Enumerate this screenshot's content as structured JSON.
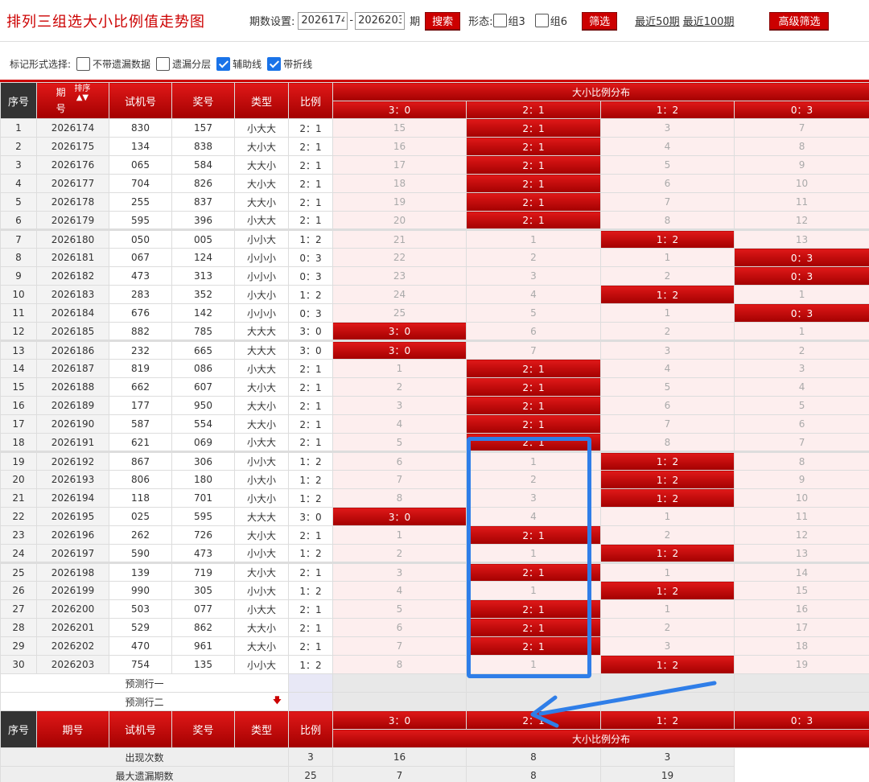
{
  "header": {
    "title": "排列三组选大小比例值走势图",
    "period_label": "期数设置:",
    "period_start": "2026174",
    "period_sep": "-",
    "period_end": "2026203",
    "period_unit": "期",
    "search_label": "搜索",
    "form_label": "形态:",
    "group3_label": "组3",
    "group6_label": "组6",
    "filter_label": "筛选",
    "recent50": "最近50期",
    "recent100": "最近100期",
    "advanced_label": "高级筛选"
  },
  "marks": {
    "label": "标记形式选择:",
    "options": [
      {
        "label": "不带遗漏数据",
        "checked": false
      },
      {
        "label": "遗漏分层",
        "checked": false
      },
      {
        "label": "辅助线",
        "checked": true
      },
      {
        "label": "带折线",
        "checked": true
      }
    ]
  },
  "table": {
    "col_seq": "序号",
    "col_period": "期号",
    "col_sort": "排序",
    "col_test": "试机号",
    "col_prize": "奖号",
    "col_type": "类型",
    "col_ratio": "比例",
    "dist_title": "大小比例分布",
    "dist_cols": [
      "3：0",
      "2：1",
      "1：2",
      "0：3"
    ],
    "rows": [
      [
        "1",
        "2026174",
        "830",
        "157",
        "小大大",
        "2：1",
        [
          "15",
          "2：1",
          "3",
          "7"
        ],
        1
      ],
      [
        "2",
        "2026175",
        "134",
        "838",
        "大小大",
        "2：1",
        [
          "16",
          "2：1",
          "4",
          "8"
        ],
        1
      ],
      [
        "3",
        "2026176",
        "065",
        "584",
        "大大小",
        "2：1",
        [
          "17",
          "2：1",
          "5",
          "9"
        ],
        1
      ],
      [
        "4",
        "2026177",
        "704",
        "826",
        "大小大",
        "2：1",
        [
          "18",
          "2：1",
          "6",
          "10"
        ],
        1
      ],
      [
        "5",
        "2026178",
        "255",
        "837",
        "大大小",
        "2：1",
        [
          "19",
          "2：1",
          "7",
          "11"
        ],
        1
      ],
      [
        "6",
        "2026179",
        "595",
        "396",
        "小大大",
        "2：1",
        [
          "20",
          "2：1",
          "8",
          "12"
        ],
        1
      ],
      [
        "7",
        "2026180",
        "050",
        "005",
        "小小大",
        "1：2",
        [
          "21",
          "1",
          "1：2",
          "13"
        ],
        2
      ],
      [
        "8",
        "2026181",
        "067",
        "124",
        "小小小",
        "0：3",
        [
          "22",
          "2",
          "1",
          "0：3"
        ],
        3
      ],
      [
        "9",
        "2026182",
        "473",
        "313",
        "小小小",
        "0：3",
        [
          "23",
          "3",
          "2",
          "0：3"
        ],
        3
      ],
      [
        "10",
        "2026183",
        "283",
        "352",
        "小大小",
        "1：2",
        [
          "24",
          "4",
          "1：2",
          "1"
        ],
        2
      ],
      [
        "11",
        "2026184",
        "676",
        "142",
        "小小小",
        "0：3",
        [
          "25",
          "5",
          "1",
          "0：3"
        ],
        3
      ],
      [
        "12",
        "2026185",
        "882",
        "785",
        "大大大",
        "3：0",
        [
          "3：0",
          "6",
          "2",
          "1"
        ],
        0
      ],
      [
        "13",
        "2026186",
        "232",
        "665",
        "大大大",
        "3：0",
        [
          "3：0",
          "7",
          "3",
          "2"
        ],
        0
      ],
      [
        "14",
        "2026187",
        "819",
        "086",
        "小大大",
        "2：1",
        [
          "1",
          "2：1",
          "4",
          "3"
        ],
        1
      ],
      [
        "15",
        "2026188",
        "662",
        "607",
        "大小大",
        "2：1",
        [
          "2",
          "2：1",
          "5",
          "4"
        ],
        1
      ],
      [
        "16",
        "2026189",
        "177",
        "950",
        "大大小",
        "2：1",
        [
          "3",
          "2：1",
          "6",
          "5"
        ],
        1
      ],
      [
        "17",
        "2026190",
        "587",
        "554",
        "大大小",
        "2：1",
        [
          "4",
          "2：1",
          "7",
          "6"
        ],
        1
      ],
      [
        "18",
        "2026191",
        "621",
        "069",
        "小大大",
        "2：1",
        [
          "5",
          "2：1",
          "8",
          "7"
        ],
        1
      ],
      [
        "19",
        "2026192",
        "867",
        "306",
        "小小大",
        "1：2",
        [
          "6",
          "1",
          "1：2",
          "8"
        ],
        2
      ],
      [
        "20",
        "2026193",
        "806",
        "180",
        "小大小",
        "1：2",
        [
          "7",
          "2",
          "1：2",
          "9"
        ],
        2
      ],
      [
        "21",
        "2026194",
        "118",
        "701",
        "小大小",
        "1：2",
        [
          "8",
          "3",
          "1：2",
          "10"
        ],
        2
      ],
      [
        "22",
        "2026195",
        "025",
        "595",
        "大大大",
        "3：0",
        [
          "3：0",
          "4",
          "1",
          "11"
        ],
        0
      ],
      [
        "23",
        "2026196",
        "262",
        "726",
        "大小大",
        "2：1",
        [
          "1",
          "2：1",
          "2",
          "12"
        ],
        1
      ],
      [
        "24",
        "2026197",
        "590",
        "473",
        "小小大",
        "1：2",
        [
          "2",
          "1",
          "1：2",
          "13"
        ],
        2
      ],
      [
        "25",
        "2026198",
        "139",
        "719",
        "大小大",
        "2：1",
        [
          "3",
          "2：1",
          "1",
          "14"
        ],
        1
      ],
      [
        "26",
        "2026199",
        "990",
        "305",
        "小小大",
        "1：2",
        [
          "4",
          "1",
          "1：2",
          "15"
        ],
        2
      ],
      [
        "27",
        "2026200",
        "503",
        "077",
        "小大大",
        "2：1",
        [
          "5",
          "2：1",
          "1",
          "16"
        ],
        1
      ],
      [
        "28",
        "2026201",
        "529",
        "862",
        "大大小",
        "2：1",
        [
          "6",
          "2：1",
          "2",
          "17"
        ],
        1
      ],
      [
        "29",
        "2026202",
        "470",
        "961",
        "大大小",
        "2：1",
        [
          "7",
          "2：1",
          "3",
          "18"
        ],
        1
      ],
      [
        "30",
        "2026203",
        "754",
        "135",
        "小小大",
        "1：2",
        [
          "8",
          "1",
          "1：2",
          "19"
        ],
        2
      ]
    ],
    "predict1": "预测行一",
    "predict2": "预测行二",
    "stats": [
      {
        "label": "出现次数",
        "type": "0",
        "ratio": "0",
        "vals": [
          "3",
          "16",
          "8",
          "3"
        ]
      },
      {
        "label": "最大遗漏期数",
        "type": "0",
        "ratio": "0",
        "vals": [
          "25",
          "7",
          "8",
          "19"
        ]
      }
    ]
  },
  "colors": {
    "accent": "#cc0000",
    "annotation": "#2f7ee8"
  }
}
